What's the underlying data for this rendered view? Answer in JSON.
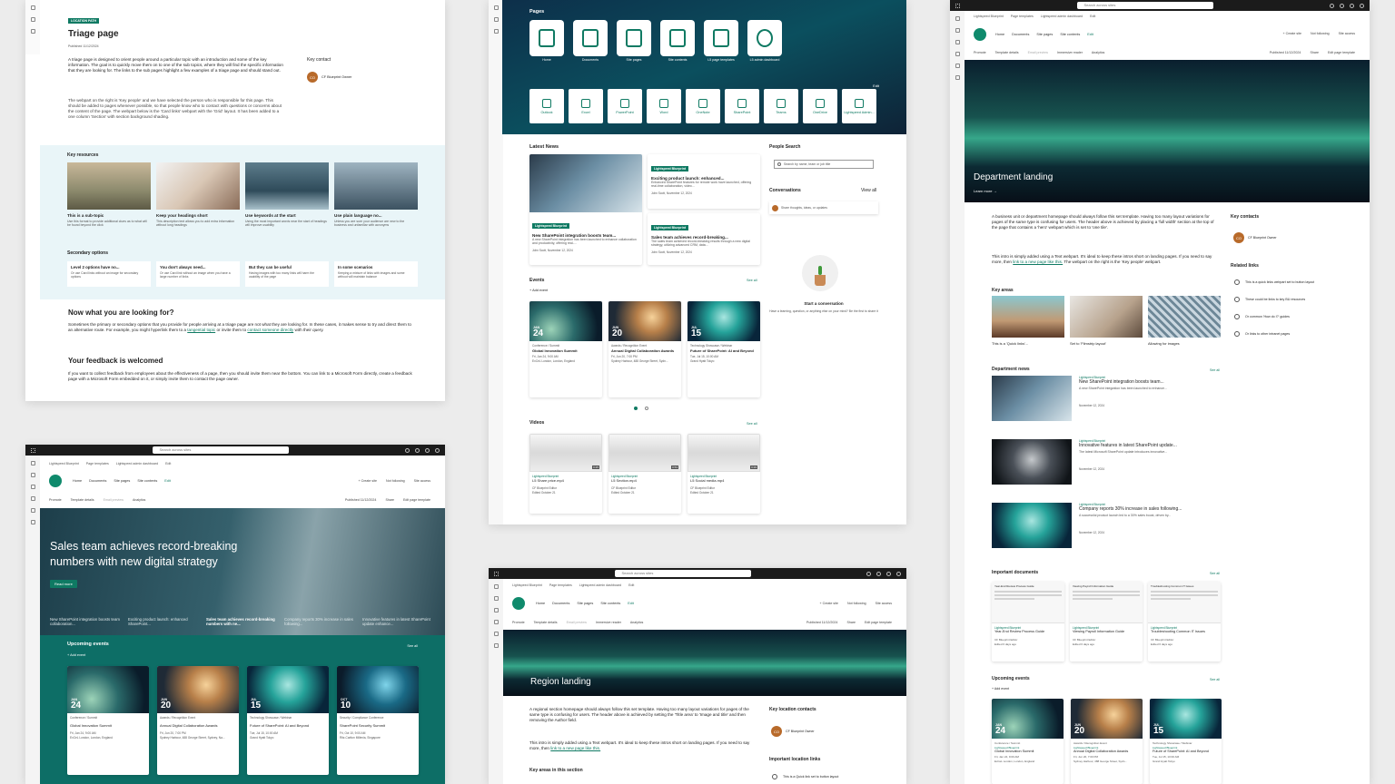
{
  "triage": {
    "badge": "LOCATION PATH",
    "title": "Triage page",
    "published": "Published 11/12/2024",
    "intro": "A triage page is designed to orient people around a particular topic with an introduction and some of the key information. The goal is to quickly move them on to one of the sub topics, where they will find the specific information that they are looking for. The links to the sub pages highlight a few examples of a triage page and should stand out.",
    "intro2": "The webpart on the right is 'Key people' and we have selected the person who is responsible for this page. This should be added to pages whenever possible, so that people know who to contact with questions or concerns about the content of the page. The webpart below is the 'Card links' webpart with the 'Grid' layout. It has been added to a one column 'Section' with section background shading.",
    "key_contact_label": "Key contact",
    "key_contact_initials": "CO",
    "key_contact_name": "CF Blueprint Owner",
    "key_resources_label": "Key resources",
    "resources": [
      {
        "title": "This is a sub-topic",
        "desc": "Use this format to provide additional clues as to what will be found beyond the click"
      },
      {
        "title": "Keep your headings short",
        "desc": "This description text allows you to add extra information without long headings"
      },
      {
        "title": "Use keywords at the start",
        "desc": "Using the most important words near the start of headings will improve usability"
      },
      {
        "title": "Use plain language no...",
        "desc": "Unless you are sure your audience are new to the business and unfamiliar with acronyms"
      }
    ],
    "secondary_label": "Secondary options",
    "secondary": [
      {
        "title": "Level 2 options have no...",
        "desc": "Or use Card links without an image for secondary options"
      },
      {
        "title": "You don't always need...",
        "desc": "Or use Card link without an image when you have a large number of links"
      },
      {
        "title": "But they can be useful",
        "desc": "Having images with too many links will harm the usability of the page"
      },
      {
        "title": "In some scenarios",
        "desc": "Keeping a mixture of links with images and some without will maintain balance"
      }
    ],
    "looking_title": "Now what you are looking for?",
    "looking_body_a": "Sometimes the primary or secondary options that you provide for people arriving at a triage page are not what they are looking for. In these cases, it makes sense to try and direct them to an alternative route. For example, you might hyperlink them to a",
    "looking_link1": "tangential topic",
    "looking_body_b": "or invite them to",
    "looking_link2": "contact someone directly",
    "looking_body_c": "with their query.",
    "feedback_title": "Your feedback is welcomed",
    "feedback_body": "If you want to collect feedback from employees about the effectiveness of a page, then you should invite them near the bottom. You can link to a Microsoft Form directly, create a feedback page with a Microsoft Form embedded on it, or simply invite them to contact the page owner."
  },
  "hub": {
    "pages_label": "Pages",
    "pages": [
      "Home",
      "Documents",
      "Site pages",
      "Site contents",
      "L5 page templates",
      "L5 admin dashboard"
    ],
    "edit_label": "Edit",
    "apps": [
      "Outlook",
      "Excel",
      "PowerPoint",
      "Word",
      "OneNote",
      "SharePoint",
      "Teams",
      "OneDrive",
      "Lightspeed Admin..."
    ],
    "latest_news_label": "Latest News",
    "news": [
      {
        "tag": "Lightspeed Blueprint",
        "title": "Exciting product launch: enhanced...",
        "desc": "Enhanced SharePoint features for remote work have launched, offering real-time collaboration, video...",
        "meta": "John Scott, November 12, 2024"
      },
      {
        "tag": "Lightspeed Blueprint",
        "title": "New SharePoint integration boosts team...",
        "desc": "A new SharePoint integration has been launched to enhance collaboration and productivity, offering real-...",
        "meta": "John Scott, November 12, 2024"
      },
      {
        "tag": "Lightspeed Blueprint",
        "title": "Sales team achieves record-breaking...",
        "desc": "The sales team achieved record-breaking results through a new digital strategy, utilizing advanced CRM, data...",
        "meta": "John Scott, November 12, 2024"
      }
    ],
    "people_search_label": "People Search",
    "people_search_placeholder": "Search by name, team or job title",
    "conversations_label": "Conversations",
    "view_all": "View all",
    "conv_placeholder": "Share thoughts, ideas, or updates",
    "start_conv_title": "Start a conversation",
    "start_conv_desc": "Have a learning, question, or anything else on your mind? Be the first to share it",
    "events_label": "Events",
    "see_all": "See all",
    "add_event": "+ Add event",
    "events": [
      {
        "month": "JAN",
        "day": "24",
        "type": "Conference / Summit",
        "title": "Global Innovation Summit",
        "when": "Fri, Jan 24, 9:00 AM",
        "where": "ExCeL London, London, England"
      },
      {
        "month": "JUN",
        "day": "20",
        "type": "Awards / Recognition Event",
        "title": "Annual Digital Collaboration Awards",
        "when": "Fri, Jun 20, 7:00 PM",
        "where": "Sydney Harbour, 488 George Street, Sydn..."
      },
      {
        "month": "JUL",
        "day": "15",
        "type": "Technology Showcase / Webinar",
        "title": "Future of SharePoint: AI and Beyond",
        "when": "Tue, Jul 15, 10:00 AM",
        "where": "Grand Hyatt Tokyo"
      }
    ],
    "videos_label": "Videos",
    "videos": [
      {
        "tag": "Lightspeed Blueprint",
        "title": "L5 Share price.mp4",
        "author": "CF Blueprint Editor",
        "when": "Edited October 21",
        "dur": "0:25"
      },
      {
        "tag": "Lightspeed Blueprint",
        "title": "L5 Section.mp4",
        "author": "CF Blueprint Editor",
        "when": "Edited October 21",
        "dur": "0:53"
      },
      {
        "tag": "Lightspeed Blueprint",
        "title": "L5 Social media.mp4",
        "author": "CF Blueprint Editor",
        "when": "Edited October 21",
        "dur": "0:29"
      }
    ]
  },
  "chrome": {
    "search_placeholder": "Search across sites",
    "site_name": "Lightspeed Blueprint",
    "page_templates": "Page templates",
    "admin_dashboard": "Lightspeed admin dashboard",
    "edit": "Edit",
    "nav": [
      "Home",
      "Documents",
      "Site pages",
      "Site contents",
      "Edit"
    ],
    "actions": [
      "+ Create site",
      "Not following",
      "Site access"
    ],
    "cmds": [
      "Promote",
      "Template details",
      "Email preview",
      "Immersive reader",
      "Analytics"
    ],
    "published": "Published 11/12/2024",
    "share": "Share",
    "edit_template": "Edit page template"
  },
  "dept": {
    "hero_title": "Department landing",
    "learn_more": "Learn more →",
    "intro": "A business unit or department homepage should always follow this set template. Having too many layout variations for pages of the same type is confusing for users. The header above is achieved by placing a 'full width' section at the top of the page that contains a 'hero' webpart",
    "intro_b": "which is set to 'one tile'.",
    "intro2_a": "This intro is simply added using a Text webpart. It's ideal to keep these intros short on landing pages. If you need to say more, then",
    "intro2_link": "link to a new page like this.",
    "intro2_b": "The webpart on the right is the 'Key people' webpart.",
    "key_contacts_label": "Key contacts",
    "key_contact_initials": "CO",
    "key_contact_name": "CF Blueprint Owner",
    "related_label": "Related links",
    "related": [
      "This is a quick links webpart set to button layout",
      "These could be links to key BU resources",
      "Or common 'How do I?' guides",
      "Or links to other intranet pages"
    ],
    "key_areas_label": "Key areas",
    "key_areas": [
      "This is a 'Quick links'...",
      "Set to 'Filmstrip layout'",
      "Allowing for images"
    ],
    "dept_news_label": "Department news",
    "see_all": "See all",
    "news": [
      {
        "tag": "Lightspeed Blueprint",
        "title": "New SharePoint integration boosts team...",
        "desc": "A new SharePoint integration has been launched to enhance...",
        "date": "November 12, 2024"
      },
      {
        "tag": "Lightspeed Blueprint",
        "title": "Innovative features in latest SharePoint update...",
        "desc": "The latest Microsoft SharePoint update introduces innovative...",
        "date": "November 12, 2024"
      },
      {
        "tag": "Lightspeed Blueprint",
        "title": "Company reports 30% increase in sales following...",
        "desc": "A successful product launch led to a 30% sales boost, driven by...",
        "date": "November 12, 2024"
      }
    ],
    "docs_label": "Important documents",
    "docs": [
      {
        "thumb": "Year-End Review Process Guide",
        "tag": "Lightspeed Blueprint",
        "title": "Year-End Review Process Guide",
        "author": "CF Blueprint Editor",
        "when": "Edited 6 days ago"
      },
      {
        "thumb": "Viewing Payroll Information Guide",
        "tag": "Lightspeed Blueprint",
        "title": "Viewing Payroll Information Guide",
        "author": "CF Blueprint Editor",
        "when": "Edited 6 days ago"
      },
      {
        "thumb": "Troubleshooting Common IT Issues",
        "tag": "Lightspeed Blueprint",
        "title": "Troubleshooting Common IT Issues",
        "author": "CF Blueprint Editor",
        "when": "Edited 6 days ago"
      }
    ],
    "events_label": "Upcoming events",
    "add_event": "+ Add event",
    "events": [
      {
        "month": "JAN",
        "day": "24",
        "type": "Conference / Summit",
        "tag": "Lightspeed Blueprint",
        "title": "Global Innovation Summit",
        "when": "Fri, Jan 24, 9:00 AM",
        "where": "ExCeL London, London, England"
      },
      {
        "month": "JUN",
        "day": "20",
        "type": "Awards / Recognition Event",
        "tag": "Lightspeed Blueprint",
        "title": "Annual Digital Collaboration Awards",
        "when": "Fri, Jun 20, 7:00 PM",
        "where": "Sydney Harbour, 488 George Street, Sydn..."
      },
      {
        "month": "JUL",
        "day": "15",
        "type": "Technology Showcase / Webinar",
        "tag": "Lightspeed Blueprint",
        "title": "Future of SharePoint: AI and Beyond",
        "when": "Tue, Jul 15, 10:00 AM",
        "where": "Grand Hyatt Tokyo"
      }
    ]
  },
  "sales": {
    "hero_title": "Sales team achieves record-breaking numbers with new digital strategy",
    "read_more": "Read more",
    "tabs": [
      "New SharePoint integration boosts team collaboration...",
      "Exciting product launch: enhanced SharePoint...",
      "Sales team achieves record-breaking numbers with ne...",
      "Company reports 30% increase in sales following...",
      "Innovative features in latest SharePoint update enhance..."
    ],
    "events_label": "Upcoming events",
    "see_all": "See all",
    "add_event": "+ Add event",
    "events": [
      {
        "month": "JAN",
        "day": "24",
        "type": "Conference / Summit",
        "title": "Global Innovation Summit",
        "when": "Fri, Jan 24, 9:00 AM",
        "where": "ExCeL London, London, England"
      },
      {
        "month": "JUN",
        "day": "20",
        "type": "Awards / Recognition Event",
        "title": "Annual Digital Collaboration Awards",
        "when": "Fri, Jun 20, 7:00 PM",
        "where": "Sydney Harbour, 488 George Street, Sydney, Na..."
      },
      {
        "month": "JUL",
        "day": "15",
        "type": "Technology Showcase / Webinar",
        "title": "Future of SharePoint: AI and Beyond",
        "when": "Tue, Jul 15, 10:00 AM",
        "where": "Grand Hyatt Tokyo"
      },
      {
        "month": "OCT",
        "day": "10",
        "type": "Security / Compliance Conference",
        "title": "SharePoint Security Summit",
        "when": "Fri, Oct 10, 9:00 AM",
        "where": "Ritz-Carlton Millenia, Singapore"
      }
    ]
  },
  "region": {
    "hero_title": "Region landing",
    "intro": "A regional section homepage should always follow this set template. Having too many layout variations for pages of the same type is confusing for users. The header above is achieved by setting the 'Title area' to 'Image and title' and then removing the Author field.",
    "intro2_a": "This intro is simply added using a Text webpart. It's ideal to keep these intros short on landing pages. If you need to say more, then",
    "intro2_link": "link to a new page like this.",
    "key_areas_label": "Key areas in this section",
    "key_contacts_label": "Key location contacts",
    "key_contact_initials": "CO",
    "key_contact_name": "CF Blueprint Owner",
    "links_label": "Important location links",
    "link1": "This is a Quick link set to button layout"
  }
}
